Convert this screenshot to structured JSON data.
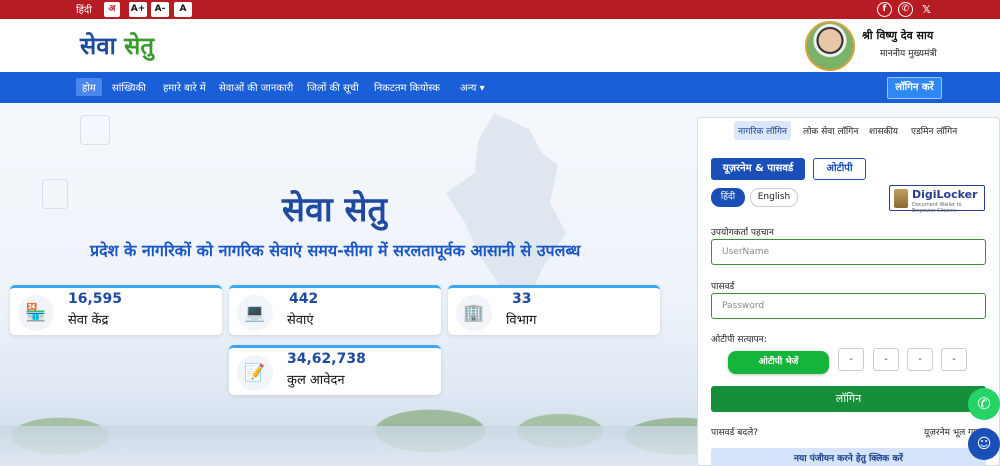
{
  "topbar": {
    "hindi_label": "हिंदी",
    "translate_icon": "translate-icon",
    "font_increase": "A+",
    "font_decrease": "A-",
    "font_normal": "A",
    "social_icons": [
      "facebook-icon",
      "whatsapp-icon",
      "x-icon"
    ]
  },
  "header": {
    "logo_part1": "सेवा",
    "logo_part2": "सेतु",
    "cm_name": "श्री विष्णु देव साय",
    "cm_title": "माननीय मुख्यमंत्री"
  },
  "nav": {
    "items": [
      "होम",
      "सांख्यिकी",
      "हमारे बारे में",
      "सेवाओं की जानकारी",
      "जिलों की सूची",
      "निकटतम कियोस्क",
      "अन्य"
    ],
    "login": "लॉगिन करें"
  },
  "hero": {
    "title": "सेवा सेतु",
    "subtitle": "प्रदेश के नागरिकों को नागरिक सेवाएं समय-सीमा में सरलतापूर्वक आसानी से उपलब्ध"
  },
  "stats": [
    {
      "value": "16,595",
      "label": "सेवा केंद्र",
      "icon": "kendra-icon"
    },
    {
      "value": "442",
      "label": "सेवाएं",
      "icon": "services-icon"
    },
    {
      "value": "33",
      "label": "विभाग",
      "icon": "department-icon"
    },
    {
      "value": "34,62,738",
      "label": "कुल आवेदन",
      "icon": "application-icon"
    }
  ],
  "login_panel": {
    "tabs": [
      "नागरिक लॉगिन",
      "लोक सेवा लॉगिन",
      "शासकीय",
      "एडमिन लॉगिन"
    ],
    "method_username": "यूज़रनेम & पासवर्ड",
    "method_otp": "ओटीपी",
    "lang_hindi": "हिंदी",
    "lang_english": "English",
    "digilocker": "DigiLocker",
    "digilocker_sub": "Document Wallet to Empower Citizens",
    "username_label": "उपयोगकर्ता पहचान",
    "username_placeholder": "UserName",
    "password_label": "पासवर्ड",
    "password_placeholder": "Password",
    "otp_label": "ओटीपी सत्यापन:",
    "otp_button": "ओटीपी भेजें",
    "otp_boxes": [
      "-",
      "-",
      "-",
      "-"
    ],
    "login_button": "लॉगिन",
    "change_password": "पासवर्ड बदले?",
    "forgot_username": "यूज़रनेम भूल गए?",
    "register": "नया पंजीयन करने हेतु क्लिक करें"
  },
  "floating": {
    "whatsapp": "whatsapp-icon",
    "chatbot": "chatbot-icon"
  }
}
